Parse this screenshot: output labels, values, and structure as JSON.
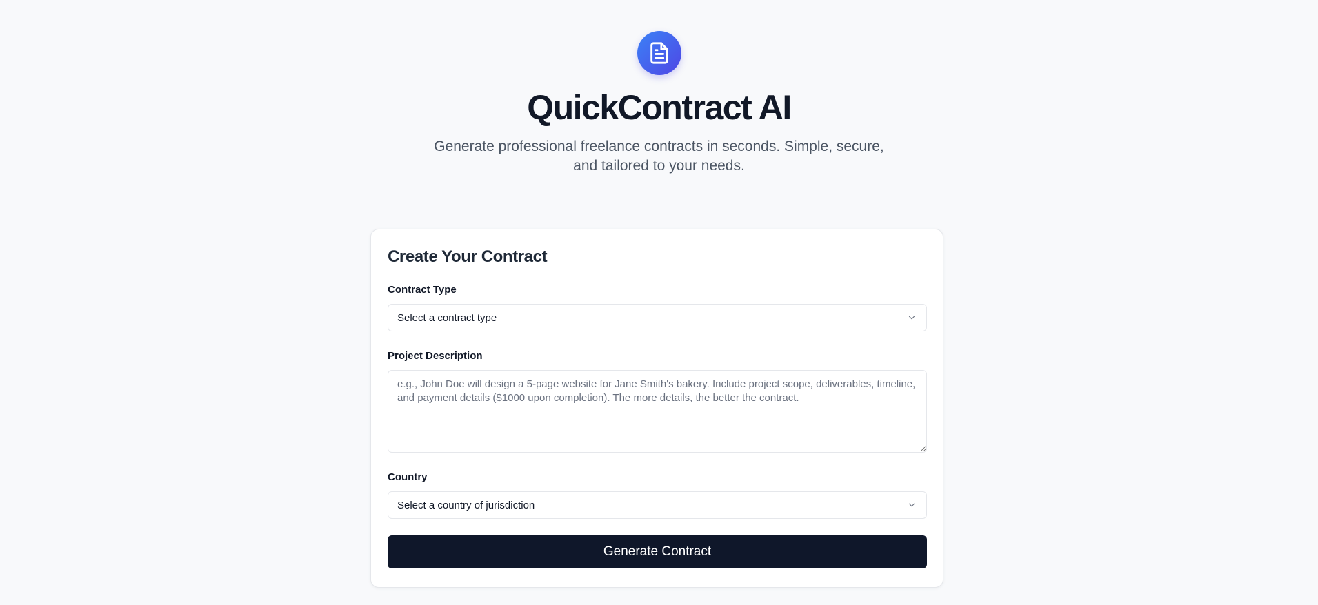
{
  "header": {
    "logo_icon": "document-icon",
    "accent_gradient": [
      "#3b82f6",
      "#4f46e5"
    ],
    "title": "QuickContract AI",
    "subtitle": "Generate professional freelance contracts in seconds. Simple, secure, and tailored to your needs."
  },
  "form": {
    "title": "Create Your Contract",
    "contract_type": {
      "label": "Contract Type",
      "selected": "Select a contract type",
      "icon": "chevron-down-icon"
    },
    "project_description": {
      "label": "Project Description",
      "value": "",
      "placeholder": "e.g., John Doe will design a 5-page website for Jane Smith's bakery. Include project scope, deliverables, timeline, and payment details ($1000 upon completion). The more details, the better the contract."
    },
    "country": {
      "label": "Country",
      "selected": "Select a country of jurisdiction",
      "icon": "chevron-down-icon"
    },
    "submit_label": "Generate Contract",
    "button_color": "#0f172a"
  }
}
